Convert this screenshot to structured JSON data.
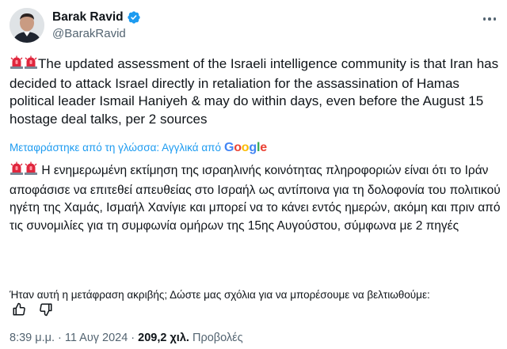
{
  "author": {
    "display_name": "Barak Ravid",
    "handle": "@BarakRavid",
    "verified": true
  },
  "tweet": {
    "text": "The updated assessment of the Israeli intelligence community is that Iran has decided to attack Israel directly in retaliation for the assassination of Hamas political leader Ismail Haniyeh & may do within days, even before the August 15 hostage deal talks, per 2 sources",
    "translation_notice": "Μεταφράστηκε από τη γλώσσα: Αγγλικά από",
    "translation_provider": "Google",
    "translated_text": "Η ενημερωμένη εκτίμηση της ισραηλινής κοινότητας πληροφοριών είναι ότι το Ιράν αποφάσισε να επιτεθεί απευθείας στο Ισραήλ ως αντίποινα για τη δολοφονία του πολιτικού ηγέτη της Χαμάς, Ισμαήλ Χανίγιε και μπορεί να το κάνει εντός ημερών, ακόμη και πριν από τις συνομιλίες για τη συμφωνία ομήρων της 15ης Αυγούστου, σύμφωνα με 2 πηγές",
    "feedback_question": "Ήταν αυτή η μετάφραση ακριβής; Δώστε μας σχόλια για να μπορέσουμε να βελτιωθούμε:",
    "time": "8:39 μ.μ.",
    "date": "11 Αυγ 2024",
    "views_count": "209,2 χιλ.",
    "views_label": "Προβολές",
    "separator": "·"
  },
  "icons": {
    "verified": "verified-badge-icon",
    "siren": "police-light-emoji",
    "thumbs_up": "thumbs-up-icon",
    "thumbs_down": "thumbs-down-icon",
    "more": "more-options-icon"
  },
  "colors": {
    "link": "#1d9bf0",
    "secondary_text": "#536471",
    "primary_text": "#0f1419"
  }
}
